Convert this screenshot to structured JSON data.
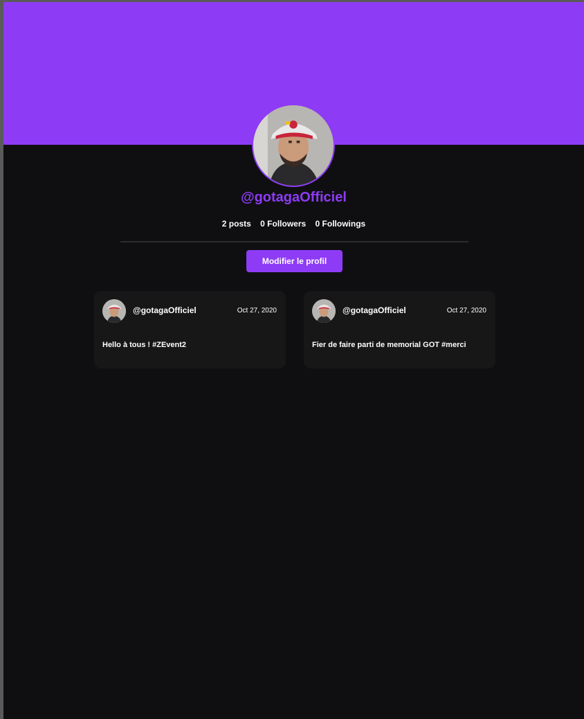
{
  "profile": {
    "username": "@gotagaOfficiel",
    "avatar_icon": "user-avatar-photo",
    "stats": {
      "posts": "2 posts",
      "followers": "0 Followers",
      "followings": "0 Followings"
    },
    "edit_button_label": "Modifier le profil"
  },
  "posts": [
    {
      "author": "@gotagaOfficiel",
      "date": "Oct 27, 2020",
      "text": "Hello à tous ! #ZEvent2"
    },
    {
      "author": "@gotagaOfficiel",
      "date": "Oct 27, 2020",
      "text": "Fier de faire parti de memorial GOT #merci"
    }
  ],
  "colors": {
    "accent": "#8e3bf5",
    "background": "#0f0f11",
    "card": "#171718"
  }
}
